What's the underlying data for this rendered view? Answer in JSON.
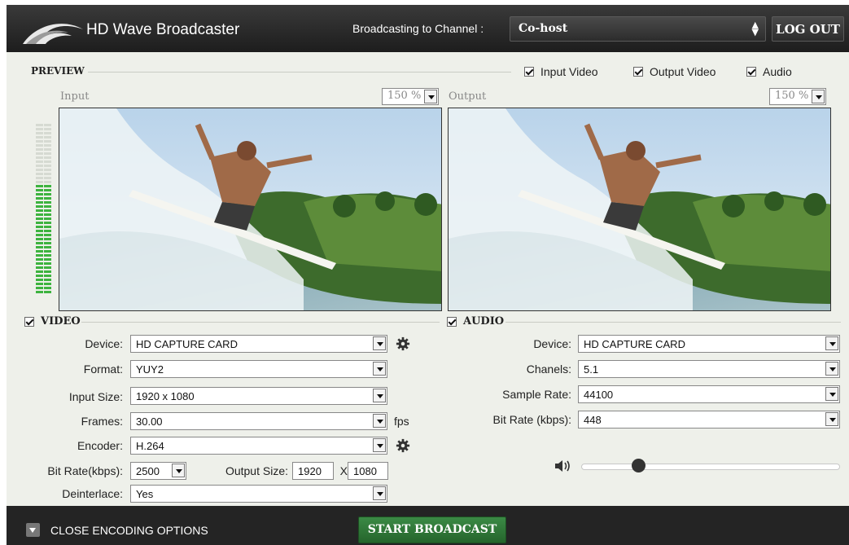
{
  "header": {
    "app_title": "HD Wave Broadcaster",
    "channel_label": "Broadcasting to Channel :",
    "channel_value": "Co-host",
    "logout_label": "LOG OUT"
  },
  "preview": {
    "title": "PREVIEW",
    "toggles": [
      {
        "label": "Input Video",
        "checked": true
      },
      {
        "label": "Output Video",
        "checked": true
      },
      {
        "label": "Audio",
        "checked": true
      }
    ],
    "input_label": "Input",
    "output_label": "Output",
    "input_zoom": "150 %",
    "output_zoom": "150 %",
    "audio_level_fraction": 0.64
  },
  "video": {
    "section_label": "VIDEO",
    "checked": true,
    "device_label": "Device:",
    "device_value": "HD CAPTURE CARD",
    "format_label": "Format:",
    "format_value": "YUY2",
    "input_size_label": "Input Size:",
    "input_size_value": "1920 x 1080",
    "frames_label": "Frames:",
    "frames_value": "30.00",
    "fps_unit": "fps",
    "encoder_label": "Encoder:",
    "encoder_value": "H.264",
    "bitrate_label": "Bit Rate(kbps):",
    "bitrate_value": "2500",
    "output_size_label": "Output Size:",
    "output_width": "1920",
    "output_x": "X",
    "output_height": "1080",
    "deinterlace_label": "Deinterlace:",
    "deinterlace_value": "Yes"
  },
  "audio": {
    "section_label": "AUDIO",
    "checked": true,
    "device_label": "Device:",
    "device_value": "HD CAPTURE CARD",
    "channels_label": "Chanels:",
    "channels_value": "5.1",
    "sample_rate_label": "Sample Rate:",
    "sample_rate_value": "44100",
    "bitrate_label": "Bit Rate (kbps):",
    "bitrate_value": "448",
    "volume_fraction": 0.22
  },
  "footer": {
    "close_label": "CLOSE ENCODING OPTIONS",
    "start_label": "START BROADCAST"
  },
  "colors": {
    "header_bg": "#242424",
    "panel_bg": "#eef0ea",
    "meter_green": "#3db33f",
    "start_green": "#2e7a36"
  }
}
